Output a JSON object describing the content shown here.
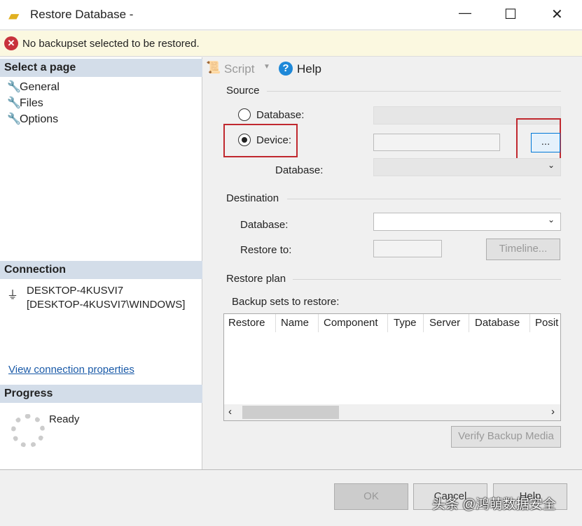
{
  "window": {
    "title": "Restore Database -",
    "min": "—",
    "max": "☐",
    "close": "✕"
  },
  "warning": {
    "text": "No backupset selected to be restored."
  },
  "left": {
    "select_page": "Select a page",
    "pages": [
      "General",
      "Files",
      "Options"
    ],
    "connection_header": "Connection",
    "server": "DESKTOP-4KUSVI7",
    "user": "[DESKTOP-4KUSVI7\\WINDOWS]",
    "view_link": "View connection properties",
    "progress_header": "Progress",
    "progress_status": "Ready"
  },
  "toolbar": {
    "script": "Script",
    "help": "Help"
  },
  "source": {
    "header": "Source",
    "database_radio": "Database:",
    "device_radio": "Device:",
    "database_label": "Database:",
    "browse": "..."
  },
  "destination": {
    "header": "Destination",
    "database_label": "Database:",
    "restore_to_label": "Restore to:",
    "timeline": "Timeline..."
  },
  "plan": {
    "header": "Restore plan",
    "backup_sets": "Backup sets to restore:",
    "columns": [
      "Restore",
      "Name",
      "Component",
      "Type",
      "Server",
      "Database",
      "Posit"
    ],
    "verify": "Verify Backup Media"
  },
  "footer": {
    "ok": "OK",
    "cancel": "Cancel",
    "help": "Help"
  },
  "watermark": "头条 @鸿萌数据安全"
}
